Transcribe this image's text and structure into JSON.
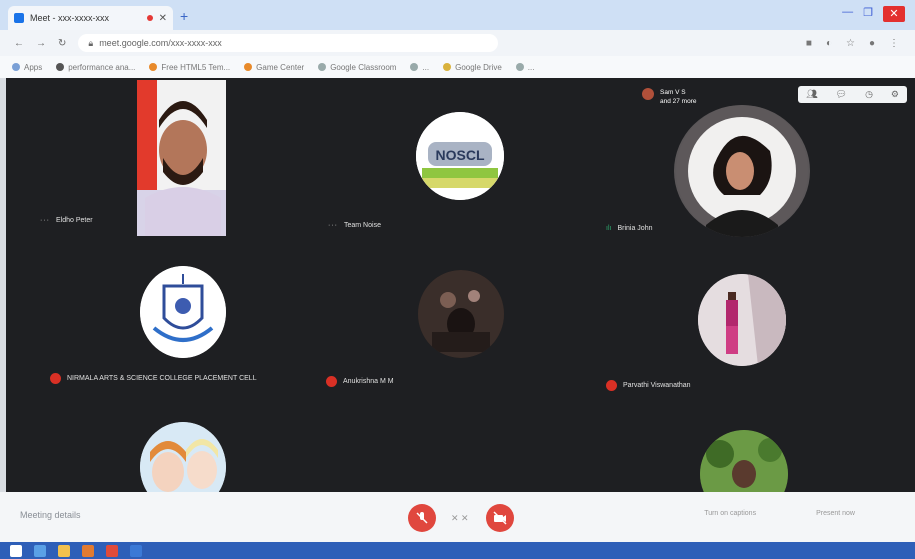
{
  "browser": {
    "tab_title": "Meet - xxx-xxxx-xxx",
    "new_tab": "+",
    "url": "meet.google.com/xxx-xxxx-xxx",
    "win_minimize": "—",
    "win_maximize": "❐",
    "win_close": "✕"
  },
  "bookmarks": [
    {
      "label": "Apps",
      "color": "#7aa0d6"
    },
    {
      "label": "performance ana...",
      "color": "#555"
    },
    {
      "label": "Free HTML5 Tem...",
      "color": "#e88a2b"
    },
    {
      "label": "Game Center",
      "color": "#e88a2b"
    },
    {
      "label": "Google Classroom",
      "color": "#9aa"
    },
    {
      "label": "...",
      "color": "#9aa"
    },
    {
      "label": "Google Drive",
      "color": "#d9b23d"
    },
    {
      "label": "...",
      "color": "#9aa"
    }
  ],
  "meet": {
    "people_indicator": {
      "line1": "Sam V S",
      "line2": "and 27 more"
    },
    "tiles": [
      {
        "name": "Eldho Peter"
      },
      {
        "name": "Team Noise"
      },
      {
        "name": "Brinia John"
      },
      {
        "name": "NIRMALA ARTS & SCIENCE COLLEGE PLACEMENT CELL"
      },
      {
        "name": "Anukrishna M M"
      },
      {
        "name": "Parvathi Viswanathan"
      }
    ],
    "logo_text": "NOSCL"
  },
  "controls": {
    "meeting_details": "Meeting details",
    "end_call": "",
    "captions": "Turn on captions",
    "present": "Present now"
  },
  "colors": {
    "meet_bg": "#1e1f22",
    "control_red": "#e0473e",
    "mute_badge": "#d93025",
    "taskbar": "#2e5fb8"
  }
}
